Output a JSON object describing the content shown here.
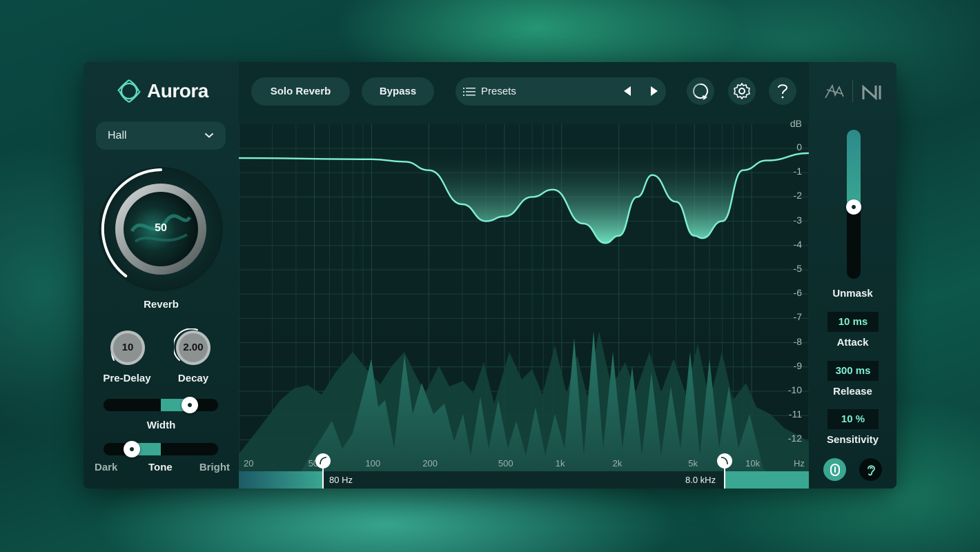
{
  "app": {
    "name": "Aurora"
  },
  "left": {
    "mode_dropdown": {
      "value": "Hall"
    },
    "reverb": {
      "value": "50",
      "label": "Reverb",
      "level": 0.5
    },
    "pre_delay": {
      "value": "10",
      "label": "Pre-Delay"
    },
    "decay": {
      "value": "2.00",
      "label": "Decay"
    },
    "width": {
      "label": "Width"
    },
    "tone": {
      "label": "Tone",
      "left_label": "Dark",
      "right_label": "Bright"
    }
  },
  "header": {
    "solo_reverb_label": "Solo Reverb",
    "bypass_label": "Bypass",
    "presets_label": "Presets",
    "icons": [
      "list-icon",
      "prev-arrow-icon",
      "next-arrow-icon",
      "history-icon",
      "gear-icon",
      "help-icon",
      "brand-mark-icon",
      "ni-logo-icon"
    ]
  },
  "graph": {
    "db_unit": "dB",
    "db_ticks": [
      "0",
      "-1",
      "-2",
      "-3",
      "-4",
      "-5",
      "-6",
      "-7",
      "-8",
      "-9",
      "-10",
      "-11",
      "-12"
    ],
    "hz_unit": "Hz",
    "hz_ticks": [
      "20",
      "50",
      "100",
      "200",
      "500",
      "1k",
      "2k",
      "5k",
      "10k"
    ],
    "low_cut": {
      "label": "80 Hz"
    },
    "high_cut": {
      "label": "8.0 kHz"
    }
  },
  "right": {
    "unmask": {
      "label": "Unmask",
      "level": 0.48
    },
    "attack": {
      "value": "10 ms",
      "label": "Attack"
    },
    "release": {
      "value": "300 ms",
      "label": "Release"
    },
    "sensitivity": {
      "value": "10 %",
      "label": "Sensitivity"
    }
  },
  "colors": {
    "accent": "#3aa792",
    "curve": "#7ff0d2",
    "panel": "#0c2b2b",
    "button": "#17403f"
  },
  "chart_data": {
    "type": "line",
    "xscale": "log",
    "xunit": "Hz",
    "yunit": "dB",
    "ylim": [
      -12.5,
      0.5
    ],
    "series": [
      {
        "x": [
          20,
          100,
          150,
          200,
          300,
          400,
          500,
          700,
          900,
          1300,
          1700,
          2000,
          2500,
          3000,
          4000,
          5000,
          5500,
          7000,
          9000,
          12000,
          20000
        ],
        "values": [
          -0.4,
          -0.45,
          -0.55,
          -0.9,
          -2.3,
          -3.0,
          -2.8,
          -2.0,
          -1.7,
          -3.1,
          -3.9,
          -3.6,
          -2.0,
          -1.1,
          -2.2,
          -3.6,
          -3.7,
          -3.0,
          -0.9,
          -0.5,
          -0.2
        ]
      }
    ]
  }
}
